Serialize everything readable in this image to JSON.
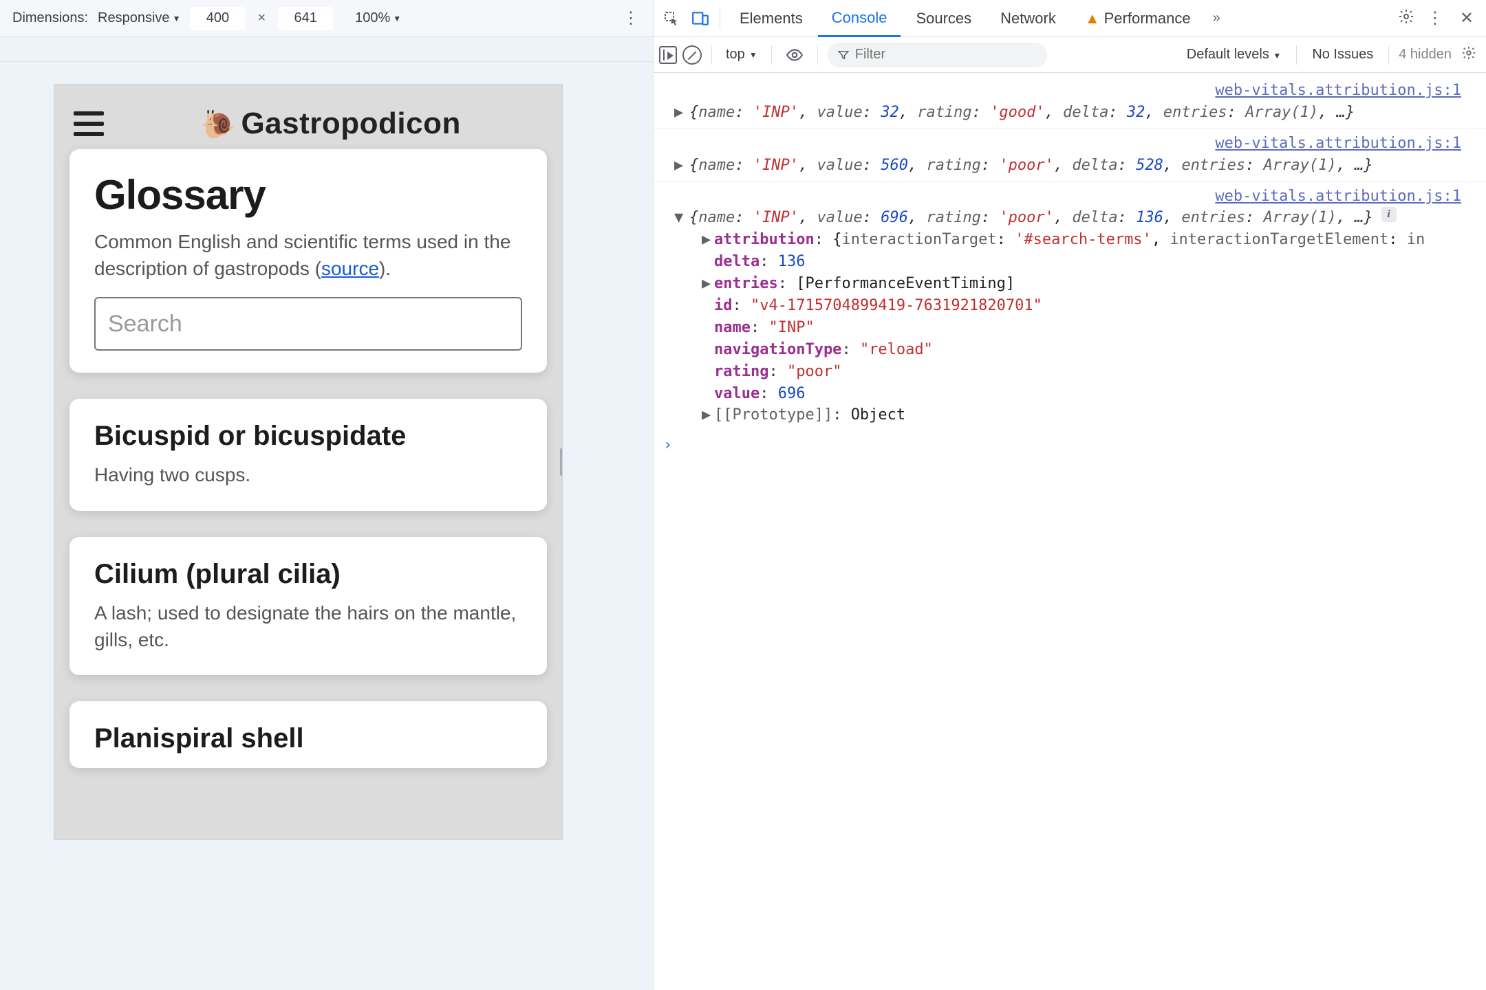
{
  "device_bar": {
    "dimensions_label": "Dimensions:",
    "device_name": "Responsive",
    "width": "400",
    "height": "641",
    "zoom": "100%"
  },
  "app": {
    "brand": "Gastropodicon",
    "snail_emoji": "🐌",
    "page_title": "Glossary",
    "page_intro_pre": "Common English and scientific terms used in the description of gastropods (",
    "page_intro_link": "source",
    "page_intro_post": ").",
    "search_placeholder": "Search",
    "terms": [
      {
        "title": "Bicuspid or bicuspidate",
        "body": "Having two cusps."
      },
      {
        "title": "Cilium (plural cilia)",
        "body": "A lash; used to designate the hairs on the mantle, gills, etc."
      },
      {
        "title": "Planispiral shell",
        "body": ""
      }
    ]
  },
  "devtools": {
    "tabs": {
      "elements": "Elements",
      "console": "Console",
      "sources": "Sources",
      "network": "Network",
      "performance": "Performance"
    },
    "toolbar": {
      "context": "top",
      "filter_placeholder": "Filter",
      "levels": "Default levels",
      "issues": "No Issues",
      "hidden": "4 hidden"
    },
    "source_link": "web-vitals.attribution.js:1",
    "entries": [
      {
        "expanded": false,
        "summary": "{name: 'INP', value: 32, rating: 'good', delta: 32, entries: Array(1), …}",
        "summary_parts": [
          {
            "t": "plain",
            "v": "{"
          },
          {
            "t": "k",
            "v": "name"
          },
          {
            "t": "plain",
            "v": ": "
          },
          {
            "t": "s",
            "v": "'INP'"
          },
          {
            "t": "plain",
            "v": ", "
          },
          {
            "t": "k",
            "v": "value"
          },
          {
            "t": "plain",
            "v": ": "
          },
          {
            "t": "n",
            "v": "32"
          },
          {
            "t": "plain",
            "v": ", "
          },
          {
            "t": "k",
            "v": "rating"
          },
          {
            "t": "plain",
            "v": ": "
          },
          {
            "t": "s",
            "v": "'good'"
          },
          {
            "t": "plain",
            "v": ", "
          },
          {
            "t": "k",
            "v": "delta"
          },
          {
            "t": "plain",
            "v": ": "
          },
          {
            "t": "n",
            "v": "32"
          },
          {
            "t": "plain",
            "v": ", "
          },
          {
            "t": "k",
            "v": "entries"
          },
          {
            "t": "plain",
            "v": ": "
          },
          {
            "t": "k",
            "v": "Array(1)"
          },
          {
            "t": "plain",
            "v": ", …}"
          }
        ]
      },
      {
        "expanded": false,
        "summary_parts": [
          {
            "t": "plain",
            "v": "{"
          },
          {
            "t": "k",
            "v": "name"
          },
          {
            "t": "plain",
            "v": ": "
          },
          {
            "t": "s",
            "v": "'INP'"
          },
          {
            "t": "plain",
            "v": ", "
          },
          {
            "t": "k",
            "v": "value"
          },
          {
            "t": "plain",
            "v": ": "
          },
          {
            "t": "n",
            "v": "560"
          },
          {
            "t": "plain",
            "v": ", "
          },
          {
            "t": "k",
            "v": "rating"
          },
          {
            "t": "plain",
            "v": ": "
          },
          {
            "t": "s",
            "v": "'poor'"
          },
          {
            "t": "plain",
            "v": ", "
          },
          {
            "t": "k",
            "v": "delta"
          },
          {
            "t": "plain",
            "v": ": "
          },
          {
            "t": "n",
            "v": "528"
          },
          {
            "t": "plain",
            "v": ", "
          },
          {
            "t": "k",
            "v": "entries"
          },
          {
            "t": "plain",
            "v": ": "
          },
          {
            "t": "k",
            "v": "Array(1)"
          },
          {
            "t": "plain",
            "v": ", …}"
          }
        ]
      },
      {
        "expanded": true,
        "summary_parts": [
          {
            "t": "plain",
            "v": "{"
          },
          {
            "t": "k",
            "v": "name"
          },
          {
            "t": "plain",
            "v": ": "
          },
          {
            "t": "s",
            "v": "'INP'"
          },
          {
            "t": "plain",
            "v": ", "
          },
          {
            "t": "k",
            "v": "value"
          },
          {
            "t": "plain",
            "v": ": "
          },
          {
            "t": "n",
            "v": "696"
          },
          {
            "t": "plain",
            "v": ", "
          },
          {
            "t": "k",
            "v": "rating"
          },
          {
            "t": "plain",
            "v": ": "
          },
          {
            "t": "s",
            "v": "'poor'"
          },
          {
            "t": "plain",
            "v": ", "
          },
          {
            "t": "k",
            "v": "delta"
          },
          {
            "t": "plain",
            "v": ": "
          },
          {
            "t": "n",
            "v": "136"
          },
          {
            "t": "plain",
            "v": ", "
          },
          {
            "t": "k",
            "v": "entries"
          },
          {
            "t": "plain",
            "v": ": "
          },
          {
            "t": "k",
            "v": "Array(1)"
          },
          {
            "t": "plain",
            "v": ", …}"
          }
        ],
        "props": [
          {
            "arrow": true,
            "name": "attribution",
            "val_parts": [
              {
                "t": "plain",
                "v": "{"
              },
              {
                "t": "grey",
                "v": "interactionTarget"
              },
              {
                "t": "plain",
                "v": ": "
              },
              {
                "t": "s",
                "v": "'#search-terms'"
              },
              {
                "t": "plain",
                "v": ", "
              },
              {
                "t": "grey",
                "v": "interactionTargetElement"
              },
              {
                "t": "plain",
                "v": ": "
              },
              {
                "t": "grey",
                "v": "in"
              }
            ]
          },
          {
            "arrow": false,
            "name": "delta",
            "val_parts": [
              {
                "t": "n",
                "v": "136"
              }
            ]
          },
          {
            "arrow": true,
            "name": "entries",
            "val_parts": [
              {
                "t": "plain",
                "v": "[PerformanceEventTiming]"
              }
            ]
          },
          {
            "arrow": false,
            "name": "id",
            "val_parts": [
              {
                "t": "s",
                "v": "\"v4-1715704899419-7631921820701\""
              }
            ]
          },
          {
            "arrow": false,
            "name": "name",
            "val_parts": [
              {
                "t": "s",
                "v": "\"INP\""
              }
            ]
          },
          {
            "arrow": false,
            "name": "navigationType",
            "val_parts": [
              {
                "t": "s",
                "v": "\"reload\""
              }
            ]
          },
          {
            "arrow": false,
            "name": "rating",
            "val_parts": [
              {
                "t": "s",
                "v": "\"poor\""
              }
            ]
          },
          {
            "arrow": false,
            "name": "value",
            "val_parts": [
              {
                "t": "n",
                "v": "696"
              }
            ]
          },
          {
            "arrow": true,
            "name": "[[Prototype]]",
            "grey": true,
            "val_parts": [
              {
                "t": "plain",
                "v": "Object"
              }
            ]
          }
        ]
      }
    ]
  }
}
